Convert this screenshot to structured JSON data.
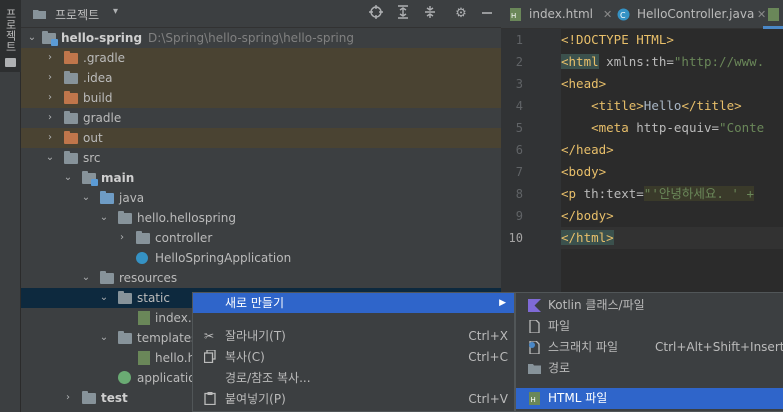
{
  "sidebar_strip": {
    "label": "프로젝트"
  },
  "project_panel": {
    "title": "프로젝트",
    "dropdown": "▾",
    "toolbar_icons": [
      "crosshair-icon",
      "expand-all-icon",
      "collapse-all-icon",
      "gear-icon",
      "minimize-icon"
    ]
  },
  "tree": {
    "root": {
      "label": "hello-spring",
      "path": "D:\\Spring\\hello-spring\\hello-spring"
    },
    "gradle_dir": ".gradle",
    "idea_dir": ".idea",
    "build_dir": "build",
    "gradle": "gradle",
    "out_dir": "out",
    "src": "src",
    "main": "main",
    "java": "java",
    "package": "hello.hellospring",
    "controller": "controller",
    "app_class": "HelloSpringApplication",
    "resources": "resources",
    "static": "static",
    "index_file": "index.h",
    "templates": "templates",
    "hello_file": "hello.h",
    "application_file": "application",
    "test": "test"
  },
  "editor": {
    "tabs": [
      {
        "label": "index.html"
      },
      {
        "label": "HelloController.java"
      }
    ],
    "line_numbers": [
      "1",
      "2",
      "3",
      "4",
      "5",
      "6",
      "7",
      "8",
      "9",
      "10"
    ],
    "lines": {
      "l1": "<!DOCTYPE HTML>",
      "l2_tag": "<html",
      "l2_attr": " xmlns:th=",
      "l2_str": "\"http://www.",
      "l3": "<head>",
      "l4_open": "    <title>",
      "l4_text": "Hello",
      "l4_close": "</title>",
      "l5_tag": "    <meta",
      "l5_attr": " http-equiv=",
      "l5_str": "\"Conte",
      "l6": "</head>",
      "l7": "<body>",
      "l8_tag": "<p",
      "l8_attr": " th:text=",
      "l8_str": "\"'안녕하세요. ' +",
      "l9": "</body>",
      "l10": "</html>"
    }
  },
  "context_menu": {
    "items": [
      {
        "label": "새로 만들기",
        "shortcut": "",
        "submenu": "▶"
      },
      {
        "label": "잘라내기(T)",
        "shortcut": "Ctrl+X",
        "icon": "scissors-icon"
      },
      {
        "label": "복사(C)",
        "shortcut": "Ctrl+C",
        "icon": "copy-icon"
      },
      {
        "label": "경로/참조 복사...",
        "shortcut": ""
      },
      {
        "label": "붙여넣기(P)",
        "shortcut": "Ctrl+V",
        "icon": "paste-icon"
      }
    ]
  },
  "submenu": {
    "items": [
      {
        "label": "Kotlin 클래스/파일",
        "shortcut": ""
      },
      {
        "label": "파일",
        "shortcut": ""
      },
      {
        "label": "스크래치 파일",
        "shortcut": "Ctrl+Alt+Shift+Insert"
      },
      {
        "label": "경로",
        "shortcut": ""
      },
      {
        "label": "HTML 파일",
        "shortcut": ""
      }
    ]
  },
  "colors": {
    "panel_bg": "#3c3f41",
    "editor_bg": "#2b2b2b",
    "selection": "#2f65ca",
    "excluded_row": "#4a4332",
    "tag": "#e8bf6a",
    "string": "#6a8759"
  }
}
